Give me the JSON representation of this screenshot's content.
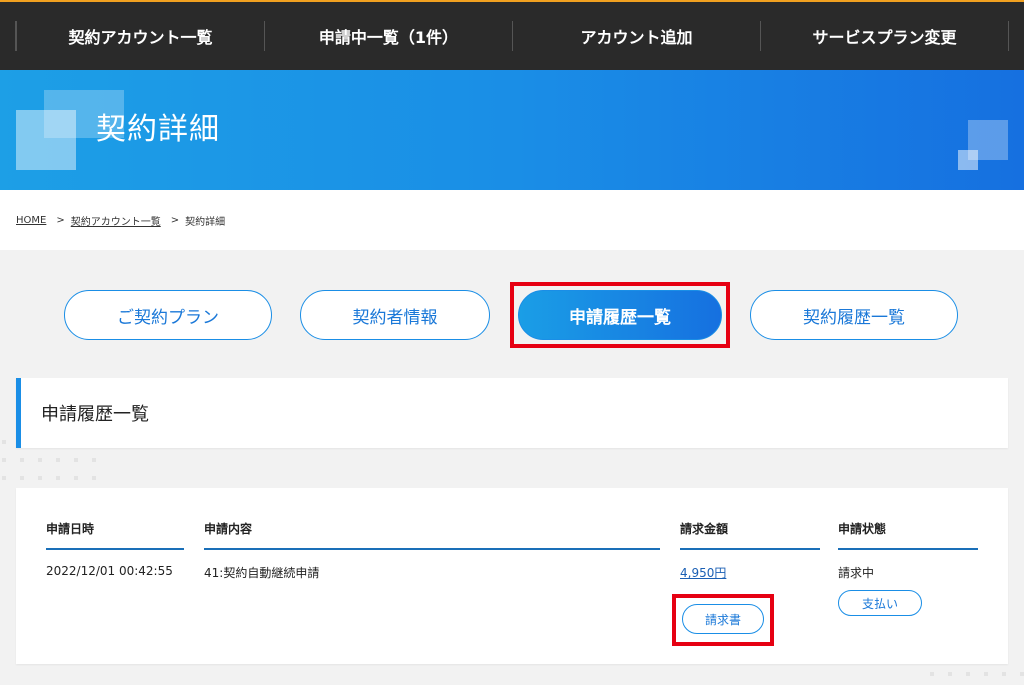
{
  "topnav": {
    "items": [
      "契約アカウント一覧",
      "申請中一覧（1件）",
      "アカウント追加",
      "サービスプラン変更"
    ]
  },
  "hero": {
    "title": "契約詳細"
  },
  "breadcrumb": {
    "home": "HOME",
    "sep": ">",
    "accounts": "契約アカウント一覧",
    "current": "契約詳細"
  },
  "tabs": [
    {
      "label": "ご契約プラン",
      "active": false
    },
    {
      "label": "契約者情報",
      "active": false
    },
    {
      "label": "申請履歴一覧",
      "active": true
    },
    {
      "label": "契約履歴一覧",
      "active": false
    }
  ],
  "section": {
    "title": "申請履歴一覧"
  },
  "table": {
    "headers": [
      "申請日時",
      "申請内容",
      "請求金額",
      "申請状態"
    ],
    "rows": [
      {
        "date": "2022/12/01 00:42:55",
        "content": "41:契約自動継続申請",
        "amount": "4,950円",
        "invoice_button": "請求書",
        "status": "請求中",
        "pay_button": "支払い"
      }
    ]
  },
  "colors": {
    "accent": "#1a8ee6",
    "highlight": "#e60012",
    "nav_bg": "#2a2a2a"
  }
}
